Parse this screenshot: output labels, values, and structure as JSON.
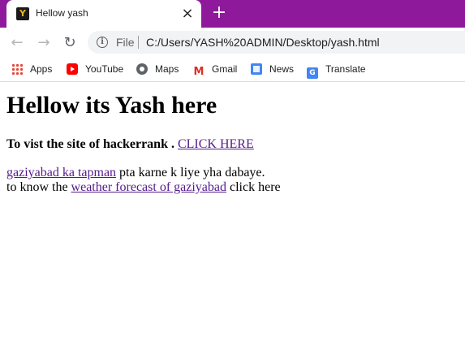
{
  "tab": {
    "title": "Hellow yash",
    "favicon": "Y",
    "close_glyph": "×",
    "new_tab_glyph": "+"
  },
  "toolbar": {
    "back_glyph": "←",
    "forward_glyph": "→",
    "reload_glyph": "↻",
    "info_glyph": "i",
    "file_label": "File",
    "url": "C:/Users/YASH%20ADMIN/Desktop/yash.html"
  },
  "bookmarks": [
    {
      "label": "Apps",
      "icon": "apps-grid-icon"
    },
    {
      "label": "YouTube",
      "icon": "youtube-icon"
    },
    {
      "label": "Maps",
      "icon": "maps-icon"
    },
    {
      "label": "Gmail",
      "icon": "gmail-icon"
    },
    {
      "label": "News",
      "icon": "news-icon"
    },
    {
      "label": "Translate",
      "icon": "translate-icon"
    }
  ],
  "page": {
    "heading": "Hellow its Yash here",
    "hackerrank_text": "To vist the site of hackerrank .",
    "hackerrank_link": "CLICK HERE",
    "tapman_link": "gaziyabad ka tapman",
    "tapman_suffix": "pta karne k liye yha dabaye.",
    "weather_prefix": "to know the",
    "weather_link": "weather forecast of gaziyabad",
    "weather_suffix": "click here"
  },
  "colors": {
    "tabstrip": "#8e1a9b",
    "visited_link": "#551a8b"
  }
}
